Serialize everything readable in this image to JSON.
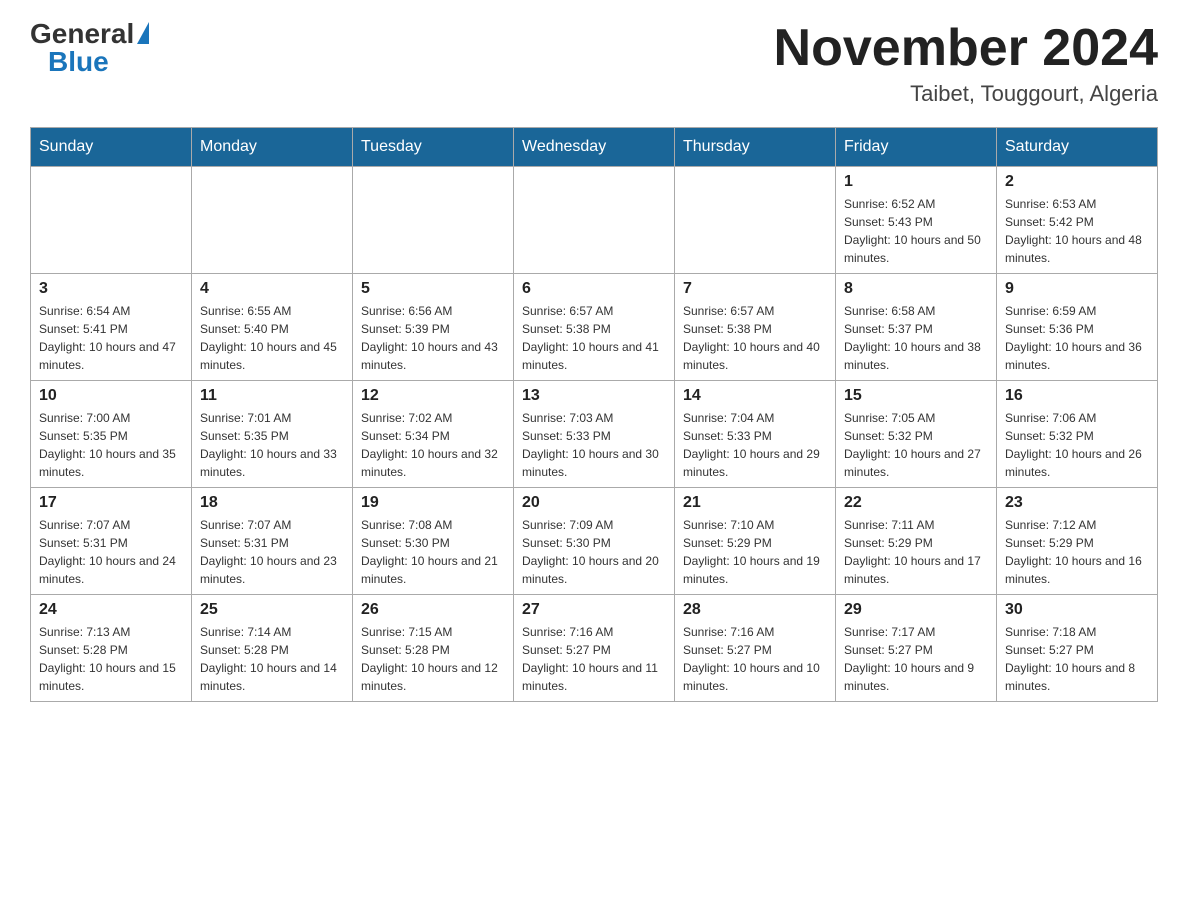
{
  "header": {
    "logo_general": "General",
    "logo_blue": "Blue",
    "month_title": "November 2024",
    "location": "Taibet, Touggourt, Algeria"
  },
  "weekdays": [
    "Sunday",
    "Monday",
    "Tuesday",
    "Wednesday",
    "Thursday",
    "Friday",
    "Saturday"
  ],
  "weeks": [
    [
      {
        "day": "",
        "sunrise": "",
        "sunset": "",
        "daylight": ""
      },
      {
        "day": "",
        "sunrise": "",
        "sunset": "",
        "daylight": ""
      },
      {
        "day": "",
        "sunrise": "",
        "sunset": "",
        "daylight": ""
      },
      {
        "day": "",
        "sunrise": "",
        "sunset": "",
        "daylight": ""
      },
      {
        "day": "",
        "sunrise": "",
        "sunset": "",
        "daylight": ""
      },
      {
        "day": "1",
        "sunrise": "Sunrise: 6:52 AM",
        "sunset": "Sunset: 5:43 PM",
        "daylight": "Daylight: 10 hours and 50 minutes."
      },
      {
        "day": "2",
        "sunrise": "Sunrise: 6:53 AM",
        "sunset": "Sunset: 5:42 PM",
        "daylight": "Daylight: 10 hours and 48 minutes."
      }
    ],
    [
      {
        "day": "3",
        "sunrise": "Sunrise: 6:54 AM",
        "sunset": "Sunset: 5:41 PM",
        "daylight": "Daylight: 10 hours and 47 minutes."
      },
      {
        "day": "4",
        "sunrise": "Sunrise: 6:55 AM",
        "sunset": "Sunset: 5:40 PM",
        "daylight": "Daylight: 10 hours and 45 minutes."
      },
      {
        "day": "5",
        "sunrise": "Sunrise: 6:56 AM",
        "sunset": "Sunset: 5:39 PM",
        "daylight": "Daylight: 10 hours and 43 minutes."
      },
      {
        "day": "6",
        "sunrise": "Sunrise: 6:57 AM",
        "sunset": "Sunset: 5:38 PM",
        "daylight": "Daylight: 10 hours and 41 minutes."
      },
      {
        "day": "7",
        "sunrise": "Sunrise: 6:57 AM",
        "sunset": "Sunset: 5:38 PM",
        "daylight": "Daylight: 10 hours and 40 minutes."
      },
      {
        "day": "8",
        "sunrise": "Sunrise: 6:58 AM",
        "sunset": "Sunset: 5:37 PM",
        "daylight": "Daylight: 10 hours and 38 minutes."
      },
      {
        "day": "9",
        "sunrise": "Sunrise: 6:59 AM",
        "sunset": "Sunset: 5:36 PM",
        "daylight": "Daylight: 10 hours and 36 minutes."
      }
    ],
    [
      {
        "day": "10",
        "sunrise": "Sunrise: 7:00 AM",
        "sunset": "Sunset: 5:35 PM",
        "daylight": "Daylight: 10 hours and 35 minutes."
      },
      {
        "day": "11",
        "sunrise": "Sunrise: 7:01 AM",
        "sunset": "Sunset: 5:35 PM",
        "daylight": "Daylight: 10 hours and 33 minutes."
      },
      {
        "day": "12",
        "sunrise": "Sunrise: 7:02 AM",
        "sunset": "Sunset: 5:34 PM",
        "daylight": "Daylight: 10 hours and 32 minutes."
      },
      {
        "day": "13",
        "sunrise": "Sunrise: 7:03 AM",
        "sunset": "Sunset: 5:33 PM",
        "daylight": "Daylight: 10 hours and 30 minutes."
      },
      {
        "day": "14",
        "sunrise": "Sunrise: 7:04 AM",
        "sunset": "Sunset: 5:33 PM",
        "daylight": "Daylight: 10 hours and 29 minutes."
      },
      {
        "day": "15",
        "sunrise": "Sunrise: 7:05 AM",
        "sunset": "Sunset: 5:32 PM",
        "daylight": "Daylight: 10 hours and 27 minutes."
      },
      {
        "day": "16",
        "sunrise": "Sunrise: 7:06 AM",
        "sunset": "Sunset: 5:32 PM",
        "daylight": "Daylight: 10 hours and 26 minutes."
      }
    ],
    [
      {
        "day": "17",
        "sunrise": "Sunrise: 7:07 AM",
        "sunset": "Sunset: 5:31 PM",
        "daylight": "Daylight: 10 hours and 24 minutes."
      },
      {
        "day": "18",
        "sunrise": "Sunrise: 7:07 AM",
        "sunset": "Sunset: 5:31 PM",
        "daylight": "Daylight: 10 hours and 23 minutes."
      },
      {
        "day": "19",
        "sunrise": "Sunrise: 7:08 AM",
        "sunset": "Sunset: 5:30 PM",
        "daylight": "Daylight: 10 hours and 21 minutes."
      },
      {
        "day": "20",
        "sunrise": "Sunrise: 7:09 AM",
        "sunset": "Sunset: 5:30 PM",
        "daylight": "Daylight: 10 hours and 20 minutes."
      },
      {
        "day": "21",
        "sunrise": "Sunrise: 7:10 AM",
        "sunset": "Sunset: 5:29 PM",
        "daylight": "Daylight: 10 hours and 19 minutes."
      },
      {
        "day": "22",
        "sunrise": "Sunrise: 7:11 AM",
        "sunset": "Sunset: 5:29 PM",
        "daylight": "Daylight: 10 hours and 17 minutes."
      },
      {
        "day": "23",
        "sunrise": "Sunrise: 7:12 AM",
        "sunset": "Sunset: 5:29 PM",
        "daylight": "Daylight: 10 hours and 16 minutes."
      }
    ],
    [
      {
        "day": "24",
        "sunrise": "Sunrise: 7:13 AM",
        "sunset": "Sunset: 5:28 PM",
        "daylight": "Daylight: 10 hours and 15 minutes."
      },
      {
        "day": "25",
        "sunrise": "Sunrise: 7:14 AM",
        "sunset": "Sunset: 5:28 PM",
        "daylight": "Daylight: 10 hours and 14 minutes."
      },
      {
        "day": "26",
        "sunrise": "Sunrise: 7:15 AM",
        "sunset": "Sunset: 5:28 PM",
        "daylight": "Daylight: 10 hours and 12 minutes."
      },
      {
        "day": "27",
        "sunrise": "Sunrise: 7:16 AM",
        "sunset": "Sunset: 5:27 PM",
        "daylight": "Daylight: 10 hours and 11 minutes."
      },
      {
        "day": "28",
        "sunrise": "Sunrise: 7:16 AM",
        "sunset": "Sunset: 5:27 PM",
        "daylight": "Daylight: 10 hours and 10 minutes."
      },
      {
        "day": "29",
        "sunrise": "Sunrise: 7:17 AM",
        "sunset": "Sunset: 5:27 PM",
        "daylight": "Daylight: 10 hours and 9 minutes."
      },
      {
        "day": "30",
        "sunrise": "Sunrise: 7:18 AM",
        "sunset": "Sunset: 5:27 PM",
        "daylight": "Daylight: 10 hours and 8 minutes."
      }
    ]
  ]
}
